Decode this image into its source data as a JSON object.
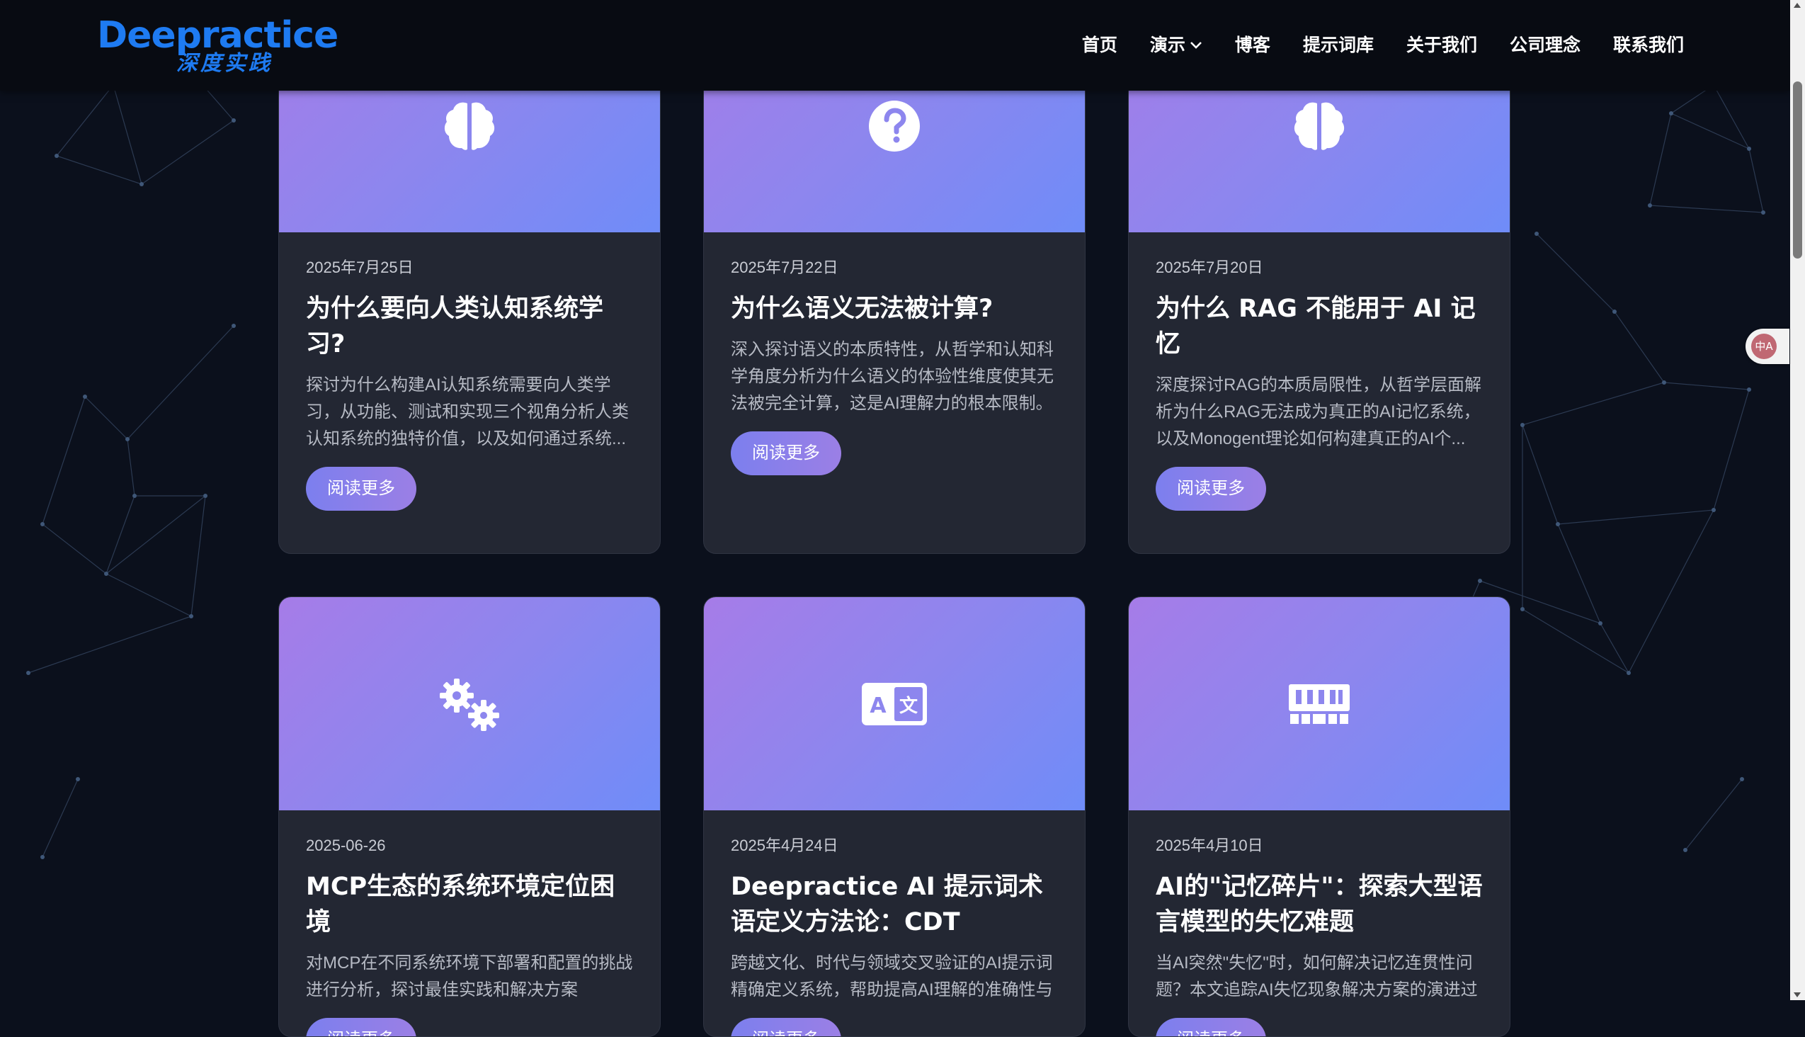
{
  "header": {
    "logo_en": "Deepractice",
    "logo_cn": "深度实践",
    "nav": [
      {
        "label": "首页",
        "name": "nav-home"
      },
      {
        "label": "演示",
        "name": "nav-demo",
        "dropdown": true
      },
      {
        "label": "博客",
        "name": "nav-blog"
      },
      {
        "label": "提示词库",
        "name": "nav-prompts"
      },
      {
        "label": "关于我们",
        "name": "nav-about"
      },
      {
        "label": "公司理念",
        "name": "nav-philosophy"
      },
      {
        "label": "联系我们",
        "name": "nav-contact"
      }
    ]
  },
  "cards": [
    {
      "icon": "brain-icon",
      "date": "2025年7月25日",
      "title": "为什么要向人类认知系统学习?",
      "desc": "探讨为什么构建AI认知系统需要向人类学习，从功能、测试和实现三个视角分析人类认知系统的独特价值，以及如何通过系统...",
      "button": "阅读更多"
    },
    {
      "icon": "question-circle-icon",
      "date": "2025年7月22日",
      "title": "为什么语义无法被计算?",
      "desc": "深入探讨语义的本质特性，从哲学和认知科学角度分析为什么语义的体验性维度使其无法被完全计算，这是AI理解力的根本限制。",
      "button": "阅读更多"
    },
    {
      "icon": "brain-icon",
      "date": "2025年7月20日",
      "title": "为什么 RAG 不能用于 AI 记忆",
      "desc": "深度探讨RAG的本质局限性，从哲学层面解析为什么RAG无法成为真正的AI记忆系统，以及Monogent理论如何构建真正的AI个...",
      "button": "阅读更多"
    },
    {
      "icon": "cogs-icon",
      "date": "2025-06-26",
      "title": "MCP生态的系统环境定位困境",
      "desc": "对MCP在不同系统环境下部署和配置的挑战进行分析，探讨最佳实践和解决方案",
      "button": "阅读更多"
    },
    {
      "icon": "language-icon",
      "date": "2025年4月24日",
      "title": "Deepractice AI 提示词术语定义方法论：CDT",
      "desc": "跨越文化、时代与领域交叉验证的AI提示词精确定义系统，帮助提高AI理解的准确性与",
      "button": "阅读更多"
    },
    {
      "icon": "memory-icon",
      "date": "2025年4月10日",
      "title": "AI的\"记忆碎片\"：探索大型语言模型的失忆难题",
      "desc": "当AI突然\"失忆\"时，如何解决记忆连贯性问题？本文追踪AI失忆现象解决方案的演进过",
      "button": "阅读更多"
    }
  ],
  "translate_widget": {
    "label": "中A",
    "icon": "translate-icon"
  },
  "colors": {
    "background": "#0b101c",
    "card": "#232733",
    "gradient_start": "#a67ce8",
    "gradient_end": "#6f8cf8",
    "brand_blue": "#1e7bf2"
  }
}
